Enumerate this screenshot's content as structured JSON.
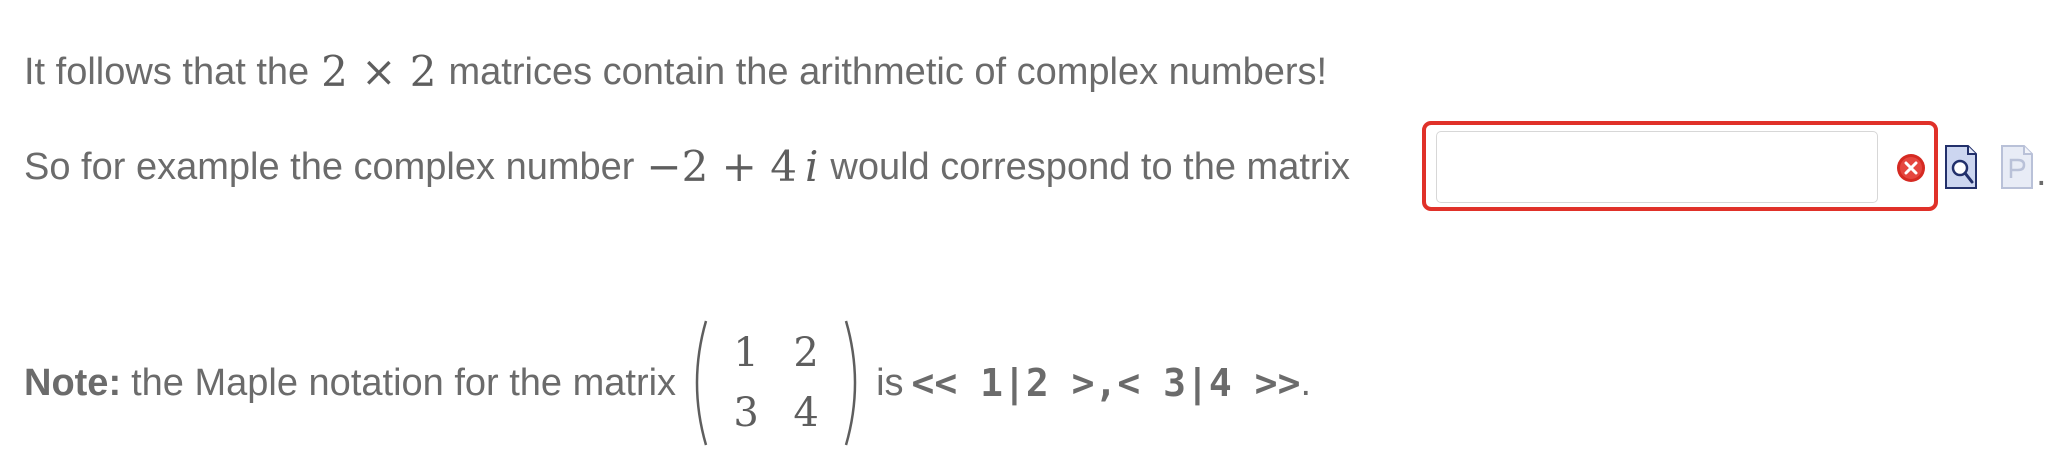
{
  "line1": {
    "before": "It follows that the",
    "math": "2 × 2",
    "after": "matrices contain the arithmetic of complex numbers!"
  },
  "line2": {
    "before": "So for example the complex number",
    "math_num": "−2 + 4",
    "math_var": "i",
    "after": "would correspond to the matrix"
  },
  "answer": {
    "value": "",
    "placeholder": "",
    "status": "incorrect",
    "status_color": "#e03129"
  },
  "trailing": ".",
  "note": {
    "label": "Note:",
    "before": "the Maple notation for the matrix",
    "matrix": [
      "1",
      "2",
      "3",
      "4"
    ],
    "is": "is",
    "code": "<< 1|2 >,< 3|4 >>",
    "end": "."
  },
  "icons": {
    "error": "error-x-icon",
    "preview": "preview-magnifier-icon",
    "syntax": "syntax-help-icon"
  }
}
